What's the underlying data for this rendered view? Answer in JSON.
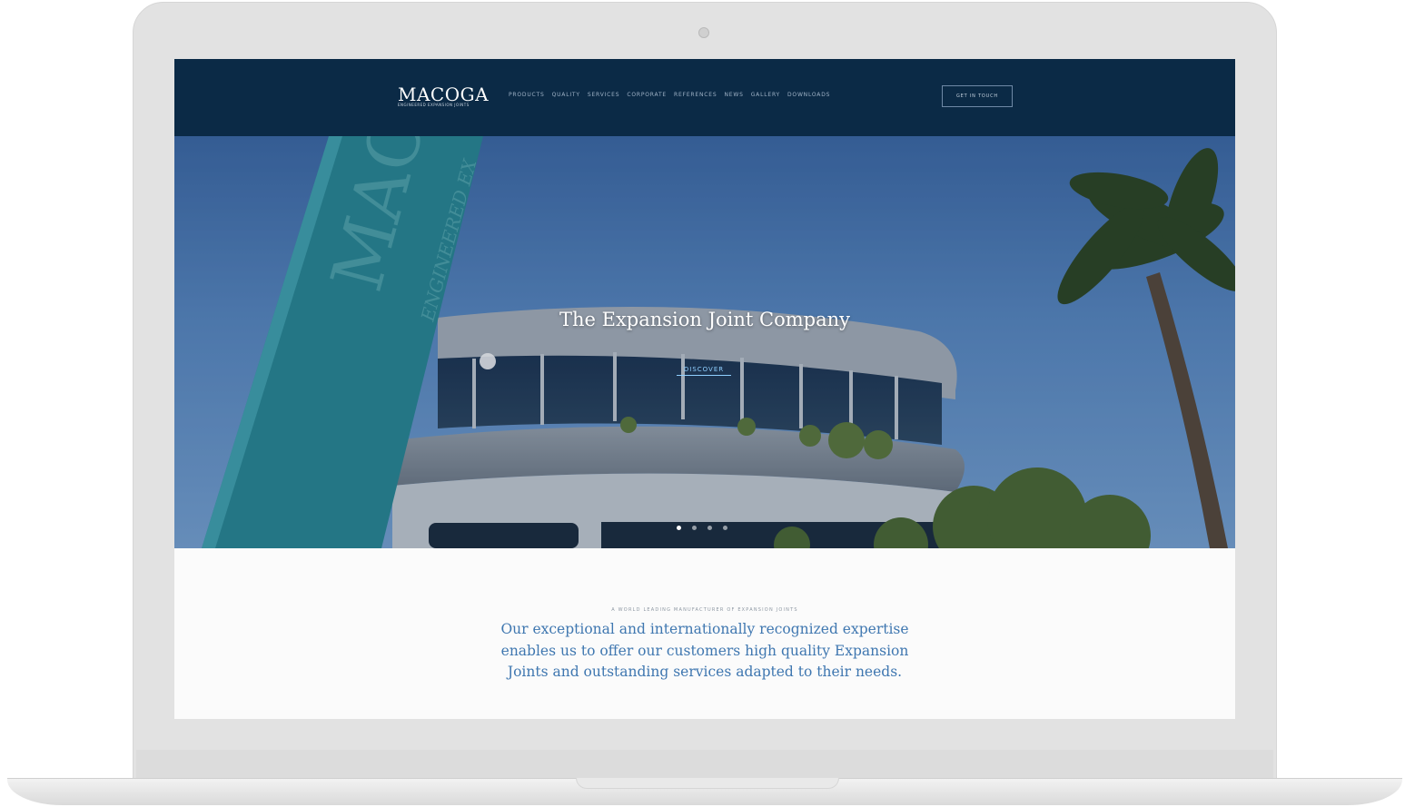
{
  "site": {
    "logo": "MACOGA",
    "logo_tagline": "ENGINEERED EXPANSION JOINTS",
    "nav": [
      "Products",
      "Quality",
      "Services",
      "Corporate",
      "References",
      "News",
      "Gallery",
      "Downloads"
    ],
    "cta_label": "Get in touch"
  },
  "hero": {
    "title": "The Expansion Joint Company",
    "discover_label": "Discover",
    "sign_text": "MAC",
    "sign_subtext": "ENGINEERED EX",
    "slides": 4,
    "active_slide": 1
  },
  "intro": {
    "eyebrow": "A world leading manufacturer of expansion joints",
    "text": "Our exceptional and internationally recognized expertise enables us to offer our customers high quality Expansion Joints and outstanding services adapted to their needs."
  },
  "colors": {
    "navbar": "#0b2a46",
    "sign_teal": "#2a8a96",
    "intro_text": "#3f77b0"
  }
}
